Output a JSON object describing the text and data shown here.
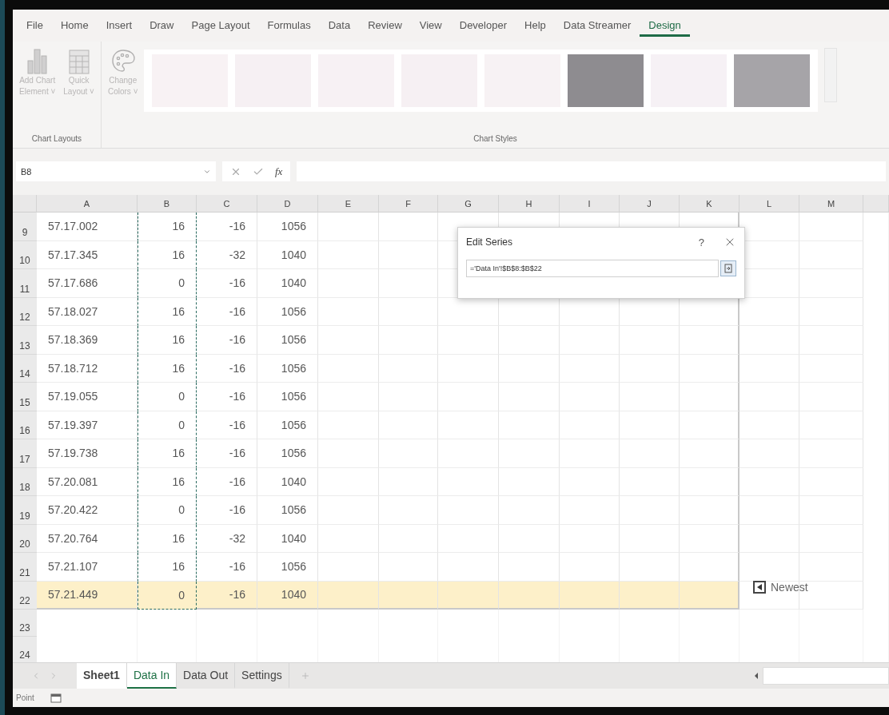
{
  "ribbon_tabs": [
    {
      "label": "File",
      "selected": false
    },
    {
      "label": "Home",
      "selected": false
    },
    {
      "label": "Insert",
      "selected": false
    },
    {
      "label": "Draw",
      "selected": false
    },
    {
      "label": "Page Layout",
      "selected": false
    },
    {
      "label": "Formulas",
      "selected": false
    },
    {
      "label": "Data",
      "selected": false
    },
    {
      "label": "Review",
      "selected": false
    },
    {
      "label": "View",
      "selected": false
    },
    {
      "label": "Developer",
      "selected": false
    },
    {
      "label": "Help",
      "selected": false
    },
    {
      "label": "Data Streamer",
      "selected": false
    },
    {
      "label": "Design",
      "selected": true
    }
  ],
  "ribbon": {
    "chart_layouts": {
      "label": "Chart Layouts",
      "buttons": [
        {
          "kind": "add-chart-element",
          "line1": "Add Chart",
          "line2": "Element ˅"
        },
        {
          "kind": "quick-layout",
          "line1": "Quick",
          "line2": "Layout ˅"
        }
      ]
    },
    "change_colors": {
      "line1": "Change",
      "line2": "Colors ˅"
    },
    "chart_styles": {
      "label": "Chart Styles",
      "thumbnails": [
        {
          "color": "#f8f2f4"
        },
        {
          "color": "#f6f0f3"
        },
        {
          "color": "#f7f1f4"
        },
        {
          "color": "#f6f0f3"
        },
        {
          "color": "#f7f2f4"
        },
        {
          "color": "#8e8c90"
        },
        {
          "color": "#f6f1f5"
        },
        {
          "color": "#a6a4a8"
        }
      ]
    }
  },
  "formula_bar": {
    "name_box": "B8",
    "function_label": "fx"
  },
  "sheet": {
    "columns": [
      {
        "label": "A",
        "marquee": false
      },
      {
        "label": "B",
        "marquee": true
      },
      {
        "label": "C",
        "marquee": false
      },
      {
        "label": "D",
        "marquee": false
      },
      {
        "label": "E",
        "marquee": false
      },
      {
        "label": "F",
        "marquee": false
      },
      {
        "label": "G",
        "marquee": false
      },
      {
        "label": "H",
        "marquee": false
      },
      {
        "label": "I",
        "marquee": false
      },
      {
        "label": "J",
        "marquee": false
      },
      {
        "label": "K",
        "marquee": false
      },
      {
        "label": "L",
        "marquee": false
      },
      {
        "label": "M",
        "marquee": false
      }
    ],
    "rows": [
      {
        "number": "9",
        "highlighted": false,
        "cells": [
          "57.17.002",
          "16",
          "-16",
          "1056"
        ]
      },
      {
        "number": "10",
        "highlighted": false,
        "cells": [
          "57.17.345",
          "16",
          "-32",
          "1040"
        ]
      },
      {
        "number": "11",
        "highlighted": false,
        "cells": [
          "57.17.686",
          "0",
          "-16",
          "1040"
        ]
      },
      {
        "number": "12",
        "highlighted": false,
        "cells": [
          "57.18.027",
          "16",
          "-16",
          "1056"
        ]
      },
      {
        "number": "13",
        "highlighted": false,
        "cells": [
          "57.18.369",
          "16",
          "-16",
          "1056"
        ]
      },
      {
        "number": "14",
        "highlighted": false,
        "cells": [
          "57.18.712",
          "16",
          "-16",
          "1056"
        ]
      },
      {
        "number": "15",
        "highlighted": false,
        "cells": [
          "57.19.055",
          "0",
          "-16",
          "1056"
        ]
      },
      {
        "number": "16",
        "highlighted": false,
        "cells": [
          "57.19.397",
          "0",
          "-16",
          "1056"
        ]
      },
      {
        "number": "17",
        "highlighted": false,
        "cells": [
          "57.19.738",
          "16",
          "-16",
          "1056"
        ]
      },
      {
        "number": "18",
        "highlighted": false,
        "cells": [
          "57.20.081",
          "16",
          "-16",
          "1040"
        ]
      },
      {
        "number": "19",
        "highlighted": false,
        "cells": [
          "57.20.422",
          "0",
          "-16",
          "1056"
        ]
      },
      {
        "number": "20",
        "highlighted": false,
        "cells": [
          "57.20.764",
          "16",
          "-32",
          "1040"
        ]
      },
      {
        "number": "21",
        "highlighted": false,
        "cells": [
          "57.21.107",
          "16",
          "-16",
          "1056"
        ]
      },
      {
        "number": "22",
        "highlighted": true,
        "cells": [
          "57.21.449",
          "0",
          "-16",
          "1040"
        ]
      },
      {
        "number": "23",
        "highlighted": false
      },
      {
        "number": "24",
        "highlighted": false
      }
    ],
    "newest_button": {
      "label": "Newest"
    }
  },
  "dialog": {
    "title": "Edit Series",
    "help": "?",
    "value": "='Data In'!$B$8:$B$22"
  },
  "sheet_tabs": [
    {
      "label": "Sheet1",
      "selected": false,
      "bold": true
    },
    {
      "label": "Data In",
      "selected": true,
      "bold": false
    },
    {
      "label": "Data Out",
      "selected": false,
      "bold": false
    },
    {
      "label": "Settings",
      "selected": false,
      "bold": false
    }
  ],
  "status_bar": {
    "mode": "Point"
  }
}
